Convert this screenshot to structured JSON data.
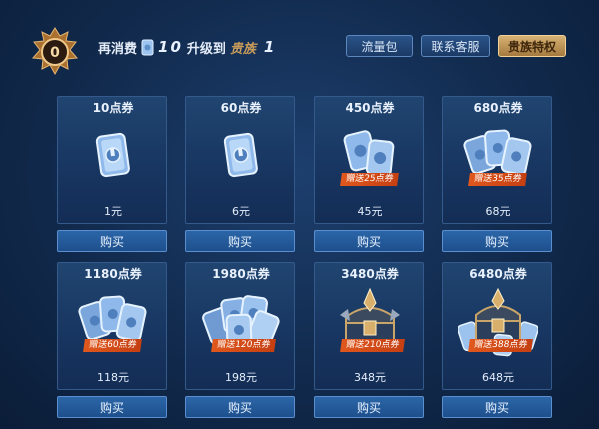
{
  "header": {
    "prefix": "再消费",
    "amount": "10",
    "upgrade_text": "升级到",
    "noble_text": "贵族",
    "noble_level": "1",
    "vip_level": "0"
  },
  "tabs": [
    {
      "label": "流量包",
      "active": false
    },
    {
      "label": "联系客服",
      "active": false
    },
    {
      "label": "贵族特权",
      "active": true
    }
  ],
  "products": [
    {
      "title": "10点券",
      "price": "1元",
      "gift": "",
      "art": "coupon-single-icon",
      "buy": "购买"
    },
    {
      "title": "60点券",
      "price": "6元",
      "gift": "",
      "art": "coupon-single-icon",
      "buy": "购买"
    },
    {
      "title": "450点券",
      "price": "45元",
      "gift": "赠送25点券",
      "art": "coupon-pair-icon",
      "buy": "购买"
    },
    {
      "title": "680点券",
      "price": "68元",
      "gift": "赠送35点券",
      "art": "coupon-stack-icon",
      "buy": "购买"
    },
    {
      "title": "1180点券",
      "price": "118元",
      "gift": "赠送60点券",
      "art": "coupon-stack-icon",
      "buy": "购买"
    },
    {
      "title": "1980点券",
      "price": "198元",
      "gift": "赠送120点券",
      "art": "coupon-pile-icon",
      "buy": "购买"
    },
    {
      "title": "3480点券",
      "price": "348元",
      "gift": "赠送210点券",
      "art": "treasure-chest-icon",
      "buy": "购买"
    },
    {
      "title": "6480点券",
      "price": "648元",
      "gift": "赠送388点券",
      "art": "treasure-chest-coupons-icon",
      "buy": "购买"
    }
  ],
  "colors": {
    "background": "#112a4d",
    "gift_badge": "#d94a17",
    "noble_gold": "#c89b5b",
    "buy_button": "#2c66a8"
  }
}
